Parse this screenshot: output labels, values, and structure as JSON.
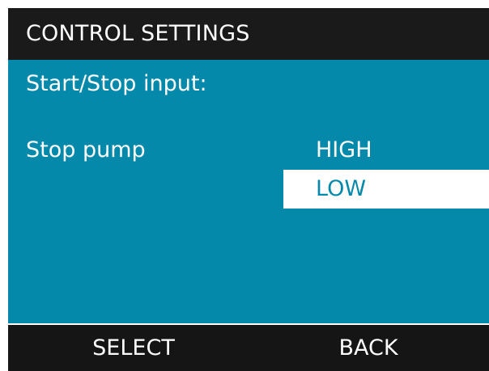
{
  "header": {
    "title": "CONTROL SETTINGS"
  },
  "main": {
    "subtitle": "Start/Stop input:",
    "parameter_label": "Stop pump",
    "options": [
      {
        "label": "HIGH",
        "selected": false
      },
      {
        "label": "LOW",
        "selected": true
      }
    ]
  },
  "softkeys": {
    "select_label": "SELECT",
    "back_label": "BACK"
  },
  "colors": {
    "panel_teal": "#0589aa",
    "header_bg": "#1a1a1a",
    "highlight_bg": "#ffffff",
    "text": "#ffffff"
  }
}
